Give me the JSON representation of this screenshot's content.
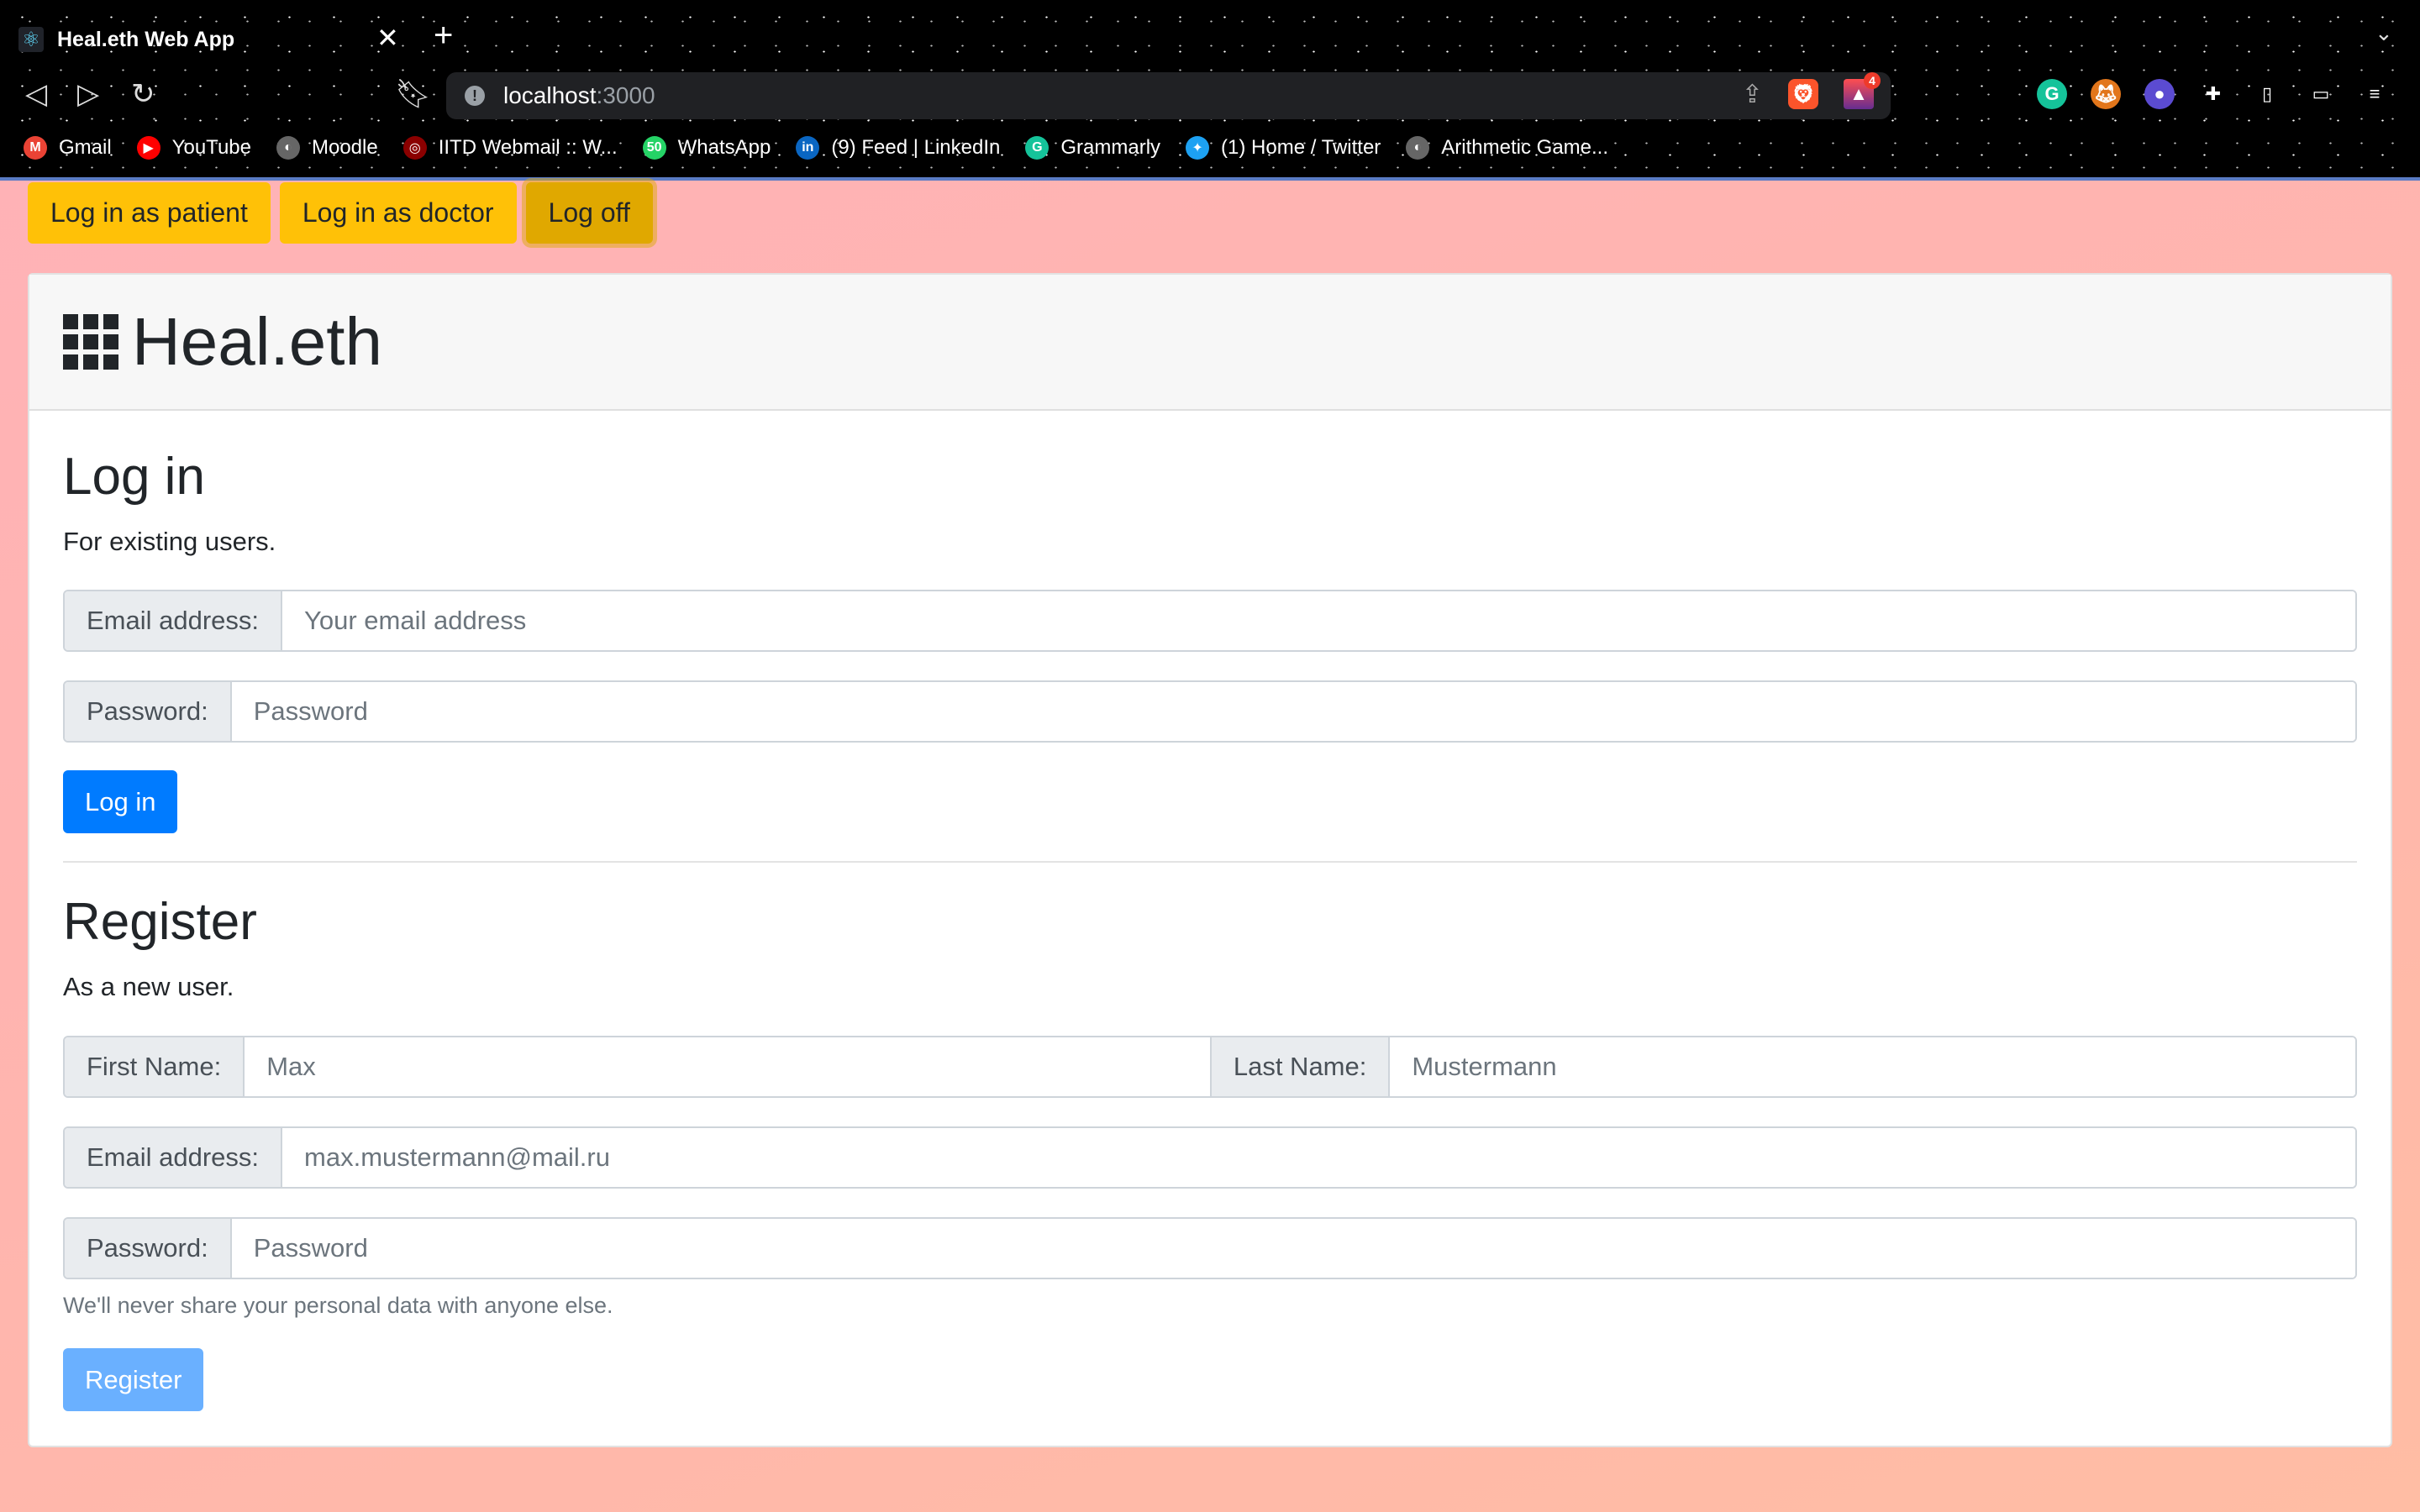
{
  "browser": {
    "tab_title": "Heal.eth Web App",
    "url_host": "localhost",
    "url_port": ":3000",
    "alert_badge": "4",
    "bookmarks": [
      {
        "label": "Gmail",
        "icon": "gmail-icon",
        "color": "#ea4335",
        "glyph": "M"
      },
      {
        "label": "YouTube",
        "icon": "youtube-icon",
        "color": "#ff0000",
        "glyph": "▶"
      },
      {
        "label": "Moodle",
        "icon": "globe-icon",
        "color": "#666666",
        "glyph": "◐"
      },
      {
        "label": "IITD Webmail :: W...",
        "icon": "webmail-icon",
        "color": "#8b0000",
        "glyph": "◎"
      },
      {
        "label": "WhatsApp",
        "icon": "whatsapp-icon",
        "color": "#25d366",
        "glyph": "50"
      },
      {
        "label": "(9) Feed | LinkedIn",
        "icon": "linkedin-icon",
        "color": "#0a66c2",
        "glyph": "in"
      },
      {
        "label": "Grammarly",
        "icon": "grammarly-icon",
        "color": "#15c39a",
        "glyph": "G"
      },
      {
        "label": "(1) Home / Twitter",
        "icon": "twitter-icon",
        "color": "#1da1f2",
        "glyph": "✦"
      },
      {
        "label": "Arithmetic Game...",
        "icon": "globe-icon",
        "color": "#666666",
        "glyph": "◐"
      }
    ]
  },
  "top_buttons": {
    "patient": "Log in as patient",
    "doctor": "Log in as doctor",
    "logoff": "Log off"
  },
  "brand": "Heal.eth",
  "login": {
    "title": "Log in",
    "subtitle": "For existing users.",
    "email_label": "Email address:",
    "email_placeholder": "Your email address",
    "password_label": "Password:",
    "password_placeholder": "Password",
    "submit": "Log in"
  },
  "register": {
    "title": "Register",
    "subtitle": "As a new user.",
    "first_label": "First Name:",
    "first_placeholder": "Max",
    "last_label": "Last Name:",
    "last_placeholder": "Mustermann",
    "email_label": "Email address:",
    "email_placeholder": "max.mustermann@mail.ru",
    "password_label": "Password:",
    "password_placeholder": "Password",
    "help": "We'll never share your personal data with anyone else.",
    "submit": "Register"
  },
  "colors": {
    "primary": "#007bff",
    "primary_disabled": "#6ab0ff",
    "warning": "#ffc107"
  }
}
